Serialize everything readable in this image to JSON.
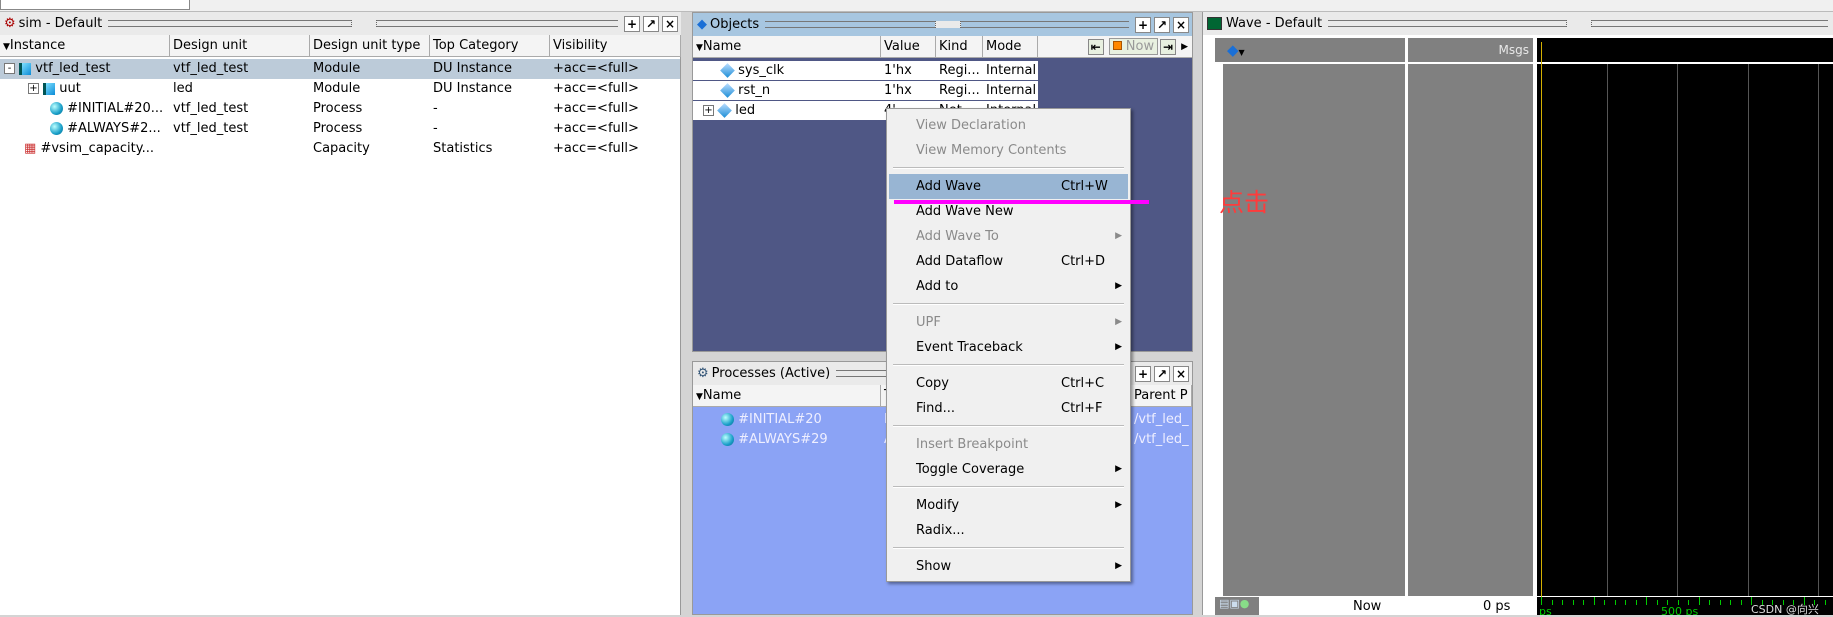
{
  "sim": {
    "title": "sim - Default",
    "columns": [
      "Instance",
      "Design unit",
      "Design unit type",
      "Top Category",
      "Visibility"
    ],
    "rows": [
      {
        "instance": "vtf_led_test",
        "unit": "vtf_led_test",
        "type": "Module",
        "category": "DU Instance",
        "visibility": "+acc=<full>",
        "icon": "module-icon",
        "expander": "-"
      },
      {
        "instance": "uut",
        "unit": "led",
        "type": "Module",
        "category": "DU Instance",
        "visibility": "+acc=<full>",
        "icon": "module-icon",
        "expander": "+"
      },
      {
        "instance": "#INITIAL#20...",
        "unit": "vtf_led_test",
        "type": "Process",
        "category": "-",
        "visibility": "+acc=<full>",
        "icon": "process-icon"
      },
      {
        "instance": "#ALWAYS#2...",
        "unit": "vtf_led_test",
        "type": "Process",
        "category": "-",
        "visibility": "+acc=<full>",
        "icon": "process-icon"
      },
      {
        "instance": "#vsim_capacity...",
        "unit": "",
        "type": "Capacity",
        "category": "Statistics",
        "visibility": "+acc=<full>",
        "icon": "capacity-icon"
      }
    ]
  },
  "objects": {
    "title": "Objects",
    "columns": [
      "Name",
      "Value",
      "Kind",
      "Mode"
    ],
    "now_label": "Now",
    "rows": [
      {
        "name": "sys_clk",
        "value": "1'hx",
        "kind": "Regi...",
        "mode": "Internal"
      },
      {
        "name": "rst_n",
        "value": "1'hx",
        "kind": "Regi...",
        "mode": "Internal"
      },
      {
        "name": "led",
        "value": "4'...",
        "kind": "Net",
        "mode": "Internal"
      }
    ]
  },
  "processes": {
    "title": "Processes (Active)",
    "columns": [
      "Name",
      "T",
      "Parent P"
    ],
    "rows": [
      {
        "name": "#INITIAL#20",
        "t": "I",
        "parent": "/vtf_led_"
      },
      {
        "name": "#ALWAYS#29",
        "t": "A",
        "parent": "/vtf_led_"
      }
    ]
  },
  "wave": {
    "title": "Wave - Default",
    "msgs": "Msgs",
    "now_label": "Now",
    "now_value": "0 ps",
    "time_start": "ps",
    "time_mark": "500 ps"
  },
  "context_menu": {
    "items": [
      {
        "label": "View Declaration",
        "disabled": true
      },
      {
        "label": "View Memory Contents",
        "disabled": true
      },
      {
        "sep": true
      },
      {
        "label": "Add Wave",
        "shortcut": "Ctrl+W",
        "highlighted": true
      },
      {
        "label": "Add Wave New"
      },
      {
        "label": "Add Wave To",
        "disabled": true,
        "submenu": true
      },
      {
        "label": "Add Dataflow",
        "shortcut": "Ctrl+D"
      },
      {
        "label": "Add to",
        "submenu": true
      },
      {
        "sep": true
      },
      {
        "label": "UPF",
        "disabled": true,
        "submenu": true
      },
      {
        "label": "Event Traceback",
        "submenu": true
      },
      {
        "sep": true
      },
      {
        "label": "Copy",
        "shortcut": "Ctrl+C"
      },
      {
        "label": "Find...",
        "shortcut": "Ctrl+F"
      },
      {
        "sep": true
      },
      {
        "label": "Insert Breakpoint",
        "disabled": true
      },
      {
        "label": "Toggle Coverage",
        "submenu": true
      },
      {
        "sep": true
      },
      {
        "label": "Modify",
        "submenu": true
      },
      {
        "label": "Radix..."
      },
      {
        "sep": true
      },
      {
        "label": "Show",
        "submenu": true
      }
    ]
  },
  "annotation": {
    "text": "点击",
    "color": "#ff3b3b",
    "underline_color": "#ff00ff"
  },
  "watermark": "CSDN @向兴"
}
